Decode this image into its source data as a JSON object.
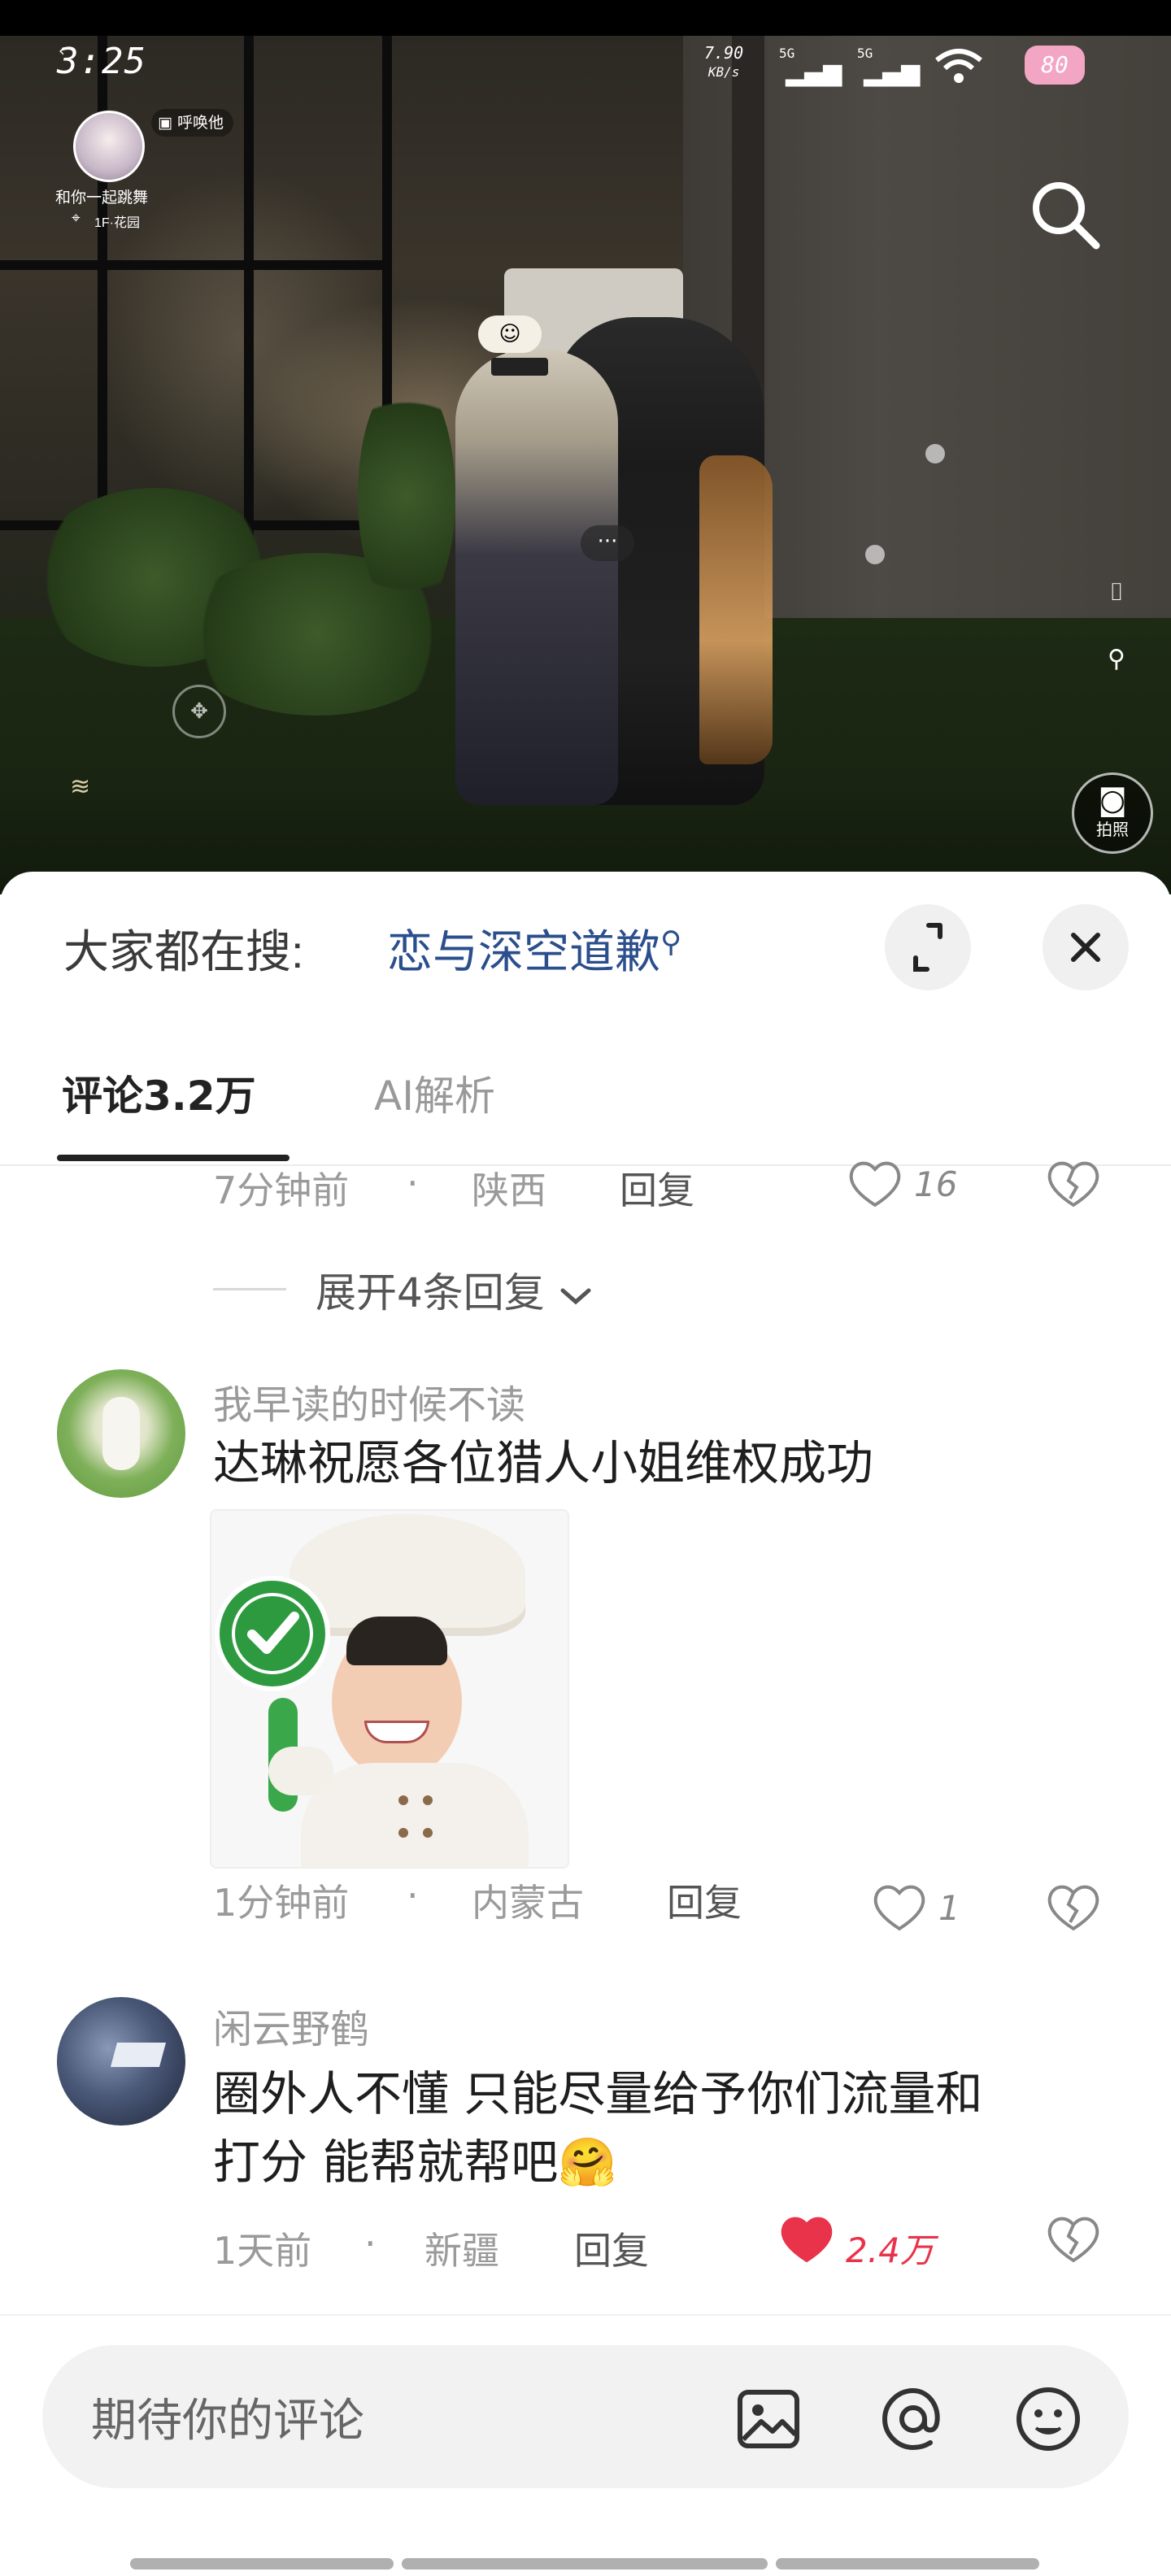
{
  "status_bar": {
    "time": "3:25",
    "net_speed_value": "7.90",
    "net_speed_unit": "KB/s",
    "signal_1": "5G",
    "signal_2": "5G",
    "battery": "80"
  },
  "game_hud": {
    "status_chip": "呼唤他",
    "avatar_caption": "和你一起跳舞",
    "location": "1F·花园",
    "photo_label": "拍照"
  },
  "search_bar": {
    "prefix": "大家都在搜:",
    "query": "恋与深空道歉"
  },
  "tabs": [
    {
      "label": "评论3.2万",
      "active": true
    },
    {
      "label": "AI解析",
      "active": false
    }
  ],
  "partial_comment": {
    "time": "7分钟前",
    "location": "陕西",
    "reply_label": "回复",
    "likes": "16"
  },
  "expand_replies": "展开4条回复",
  "comments": [
    {
      "username": "我早读的时候不读",
      "text": "达琳祝愿各位猎人小姐维权成功",
      "has_sticker": true,
      "time": "1分钟前",
      "location": "内蒙古",
      "reply_label": "回复",
      "likes": "1",
      "liked": false
    },
    {
      "username": "闲云野鹤",
      "text_line1": "圈外人不懂 只能尽量给予你们流量和",
      "text_line2": "打分 能帮就帮吧🤗",
      "time": "1天前",
      "location": "新疆",
      "reply_label": "回复",
      "likes": "2.4万",
      "liked": true
    }
  ],
  "composer": {
    "placeholder": "期待你的评论"
  },
  "colors": {
    "accent_blue": "#2b4e8c",
    "like_red": "#e8334a",
    "text_primary": "#1e1e1e",
    "text_secondary": "#9a9a9a"
  }
}
